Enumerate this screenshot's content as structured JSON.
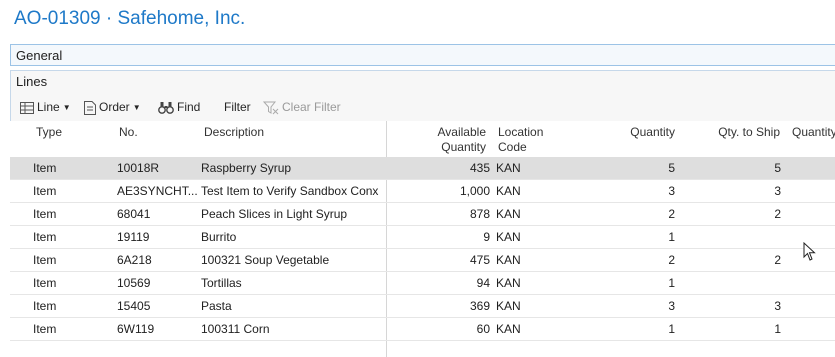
{
  "page": {
    "title": "AO-01309 · Safehome, Inc."
  },
  "tabs": {
    "general": "General",
    "lines": "Lines"
  },
  "actions": {
    "line": "Line",
    "line_icon": "grid-icon",
    "order": "Order",
    "order_icon": "document-icon",
    "find": "Find",
    "find_icon": "binoculars-icon",
    "filter": "Filter",
    "clear_filter": "Clear Filter",
    "clear_filter_icon": "clear-filter-icon"
  },
  "table": {
    "headers": {
      "type": "Type",
      "no": "No.",
      "description": "Description",
      "available_1": "Available",
      "available_2": "Quantity",
      "location_1": "Location",
      "location_2": "Code",
      "quantity": "Quantity",
      "qty_to_ship": "Qty. to Ship",
      "quantity_cut": "Quantity"
    },
    "rows": [
      {
        "type": "Item",
        "no": "10018R",
        "description": "Raspberry Syrup",
        "available": "435",
        "location": "KAN",
        "quantity": "5",
        "qty_to_ship": "5"
      },
      {
        "type": "Item",
        "no": "AE3SYNCHT...",
        "description": "Test Item to Verify Sandbox Conx",
        "available": "1,000",
        "location": "KAN",
        "quantity": "3",
        "qty_to_ship": "3"
      },
      {
        "type": "Item",
        "no": "68041",
        "description": "Peach Slices in Light Syrup",
        "available": "878",
        "location": "KAN",
        "quantity": "2",
        "qty_to_ship": "2"
      },
      {
        "type": "Item",
        "no": "19119",
        "description": "Burrito",
        "available": "9",
        "location": "KAN",
        "quantity": "1",
        "qty_to_ship": ""
      },
      {
        "type": "Item",
        "no": "6A218",
        "description": "100321 Soup Vegetable",
        "available": "475",
        "location": "KAN",
        "quantity": "2",
        "qty_to_ship": "2"
      },
      {
        "type": "Item",
        "no": "10569",
        "description": "Tortillas",
        "available": "94",
        "location": "KAN",
        "quantity": "1",
        "qty_to_ship": ""
      },
      {
        "type": "Item",
        "no": "15405",
        "description": "Pasta",
        "available": "369",
        "location": "KAN",
        "quantity": "3",
        "qty_to_ship": "3"
      },
      {
        "type": "Item",
        "no": "6W119",
        "description": "100311 Corn",
        "available": "60",
        "location": "KAN",
        "quantity": "1",
        "qty_to_ship": "1"
      }
    ]
  },
  "colors": {
    "title": "#1e79c8",
    "selected_row": "#dedede",
    "border": "#c6d8ea"
  }
}
